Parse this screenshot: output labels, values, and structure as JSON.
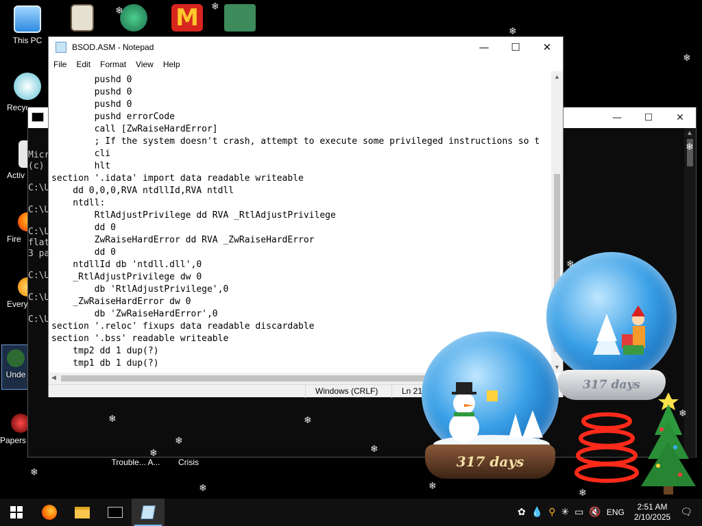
{
  "desktop": {
    "icons": [
      {
        "label": "This PC"
      },
      {
        "label": "Recyc"
      },
      {
        "label": "Activ"
      },
      {
        "label": "Fire"
      },
      {
        "label": "Every"
      },
      {
        "label": "Unde"
      },
      {
        "label": "Papers"
      },
      {
        "label": "Trouble... A..."
      },
      {
        "label": "Crisis"
      }
    ]
  },
  "console": {
    "lines": [
      "Micr",
      "(c)",
      "C:\\U",
      "C:\\U",
      "C:\\U",
      "flat",
      "3 pa",
      "C:\\U",
      "C:\\U",
      "C:\\U"
    ]
  },
  "notepad": {
    "title": "BSOD.ASM - Notepad",
    "menu": [
      "File",
      "Edit",
      "Format",
      "View",
      "Help"
    ],
    "code": [
      "        pushd 0",
      "        pushd 0",
      "        pushd 0",
      "        pushd errorCode",
      "        call [ZwRaiseHardError]",
      "        ; If the system doesn't crash, attempt to execute some privileged instructions so t",
      "        cli",
      "        hlt",
      "section '.idata' import data readable writeable",
      "    dd 0,0,0,RVA ntdllId,RVA ntdll",
      "    ntdll:",
      "        RtlAdjustPrivilege dd RVA _RtlAdjustPrivilege",
      "        dd 0",
      "        ZwRaiseHardError dd RVA _ZwRaiseHardError",
      "        dd 0",
      "    ntdllId db 'ntdll.dll',0",
      "    _RtlAdjustPrivilege dw 0",
      "        db 'RtlAdjustPrivilege',0",
      "    _ZwRaiseHardError dw 0",
      "        db 'ZwRaiseHardError',0",
      "section '.reloc' fixups data readable discardable",
      "section '.bss' readable writeable",
      "    tmp2 dd 1 dup(?)",
      "    tmp1 db 1 dup(?)"
    ],
    "status": {
      "encoding": "Windows (CRLF)",
      "position": "Ln 21,"
    }
  },
  "globes": {
    "front_days": "317 days",
    "back_days": "317 days"
  },
  "taskbar": {
    "lang": "ENG",
    "time": "2:51 AM",
    "date": "2/10/2025"
  },
  "colors": {
    "taskbar_bg": "#101010",
    "accent": "#76b9ed",
    "notepad_bg": "#ffffff"
  }
}
